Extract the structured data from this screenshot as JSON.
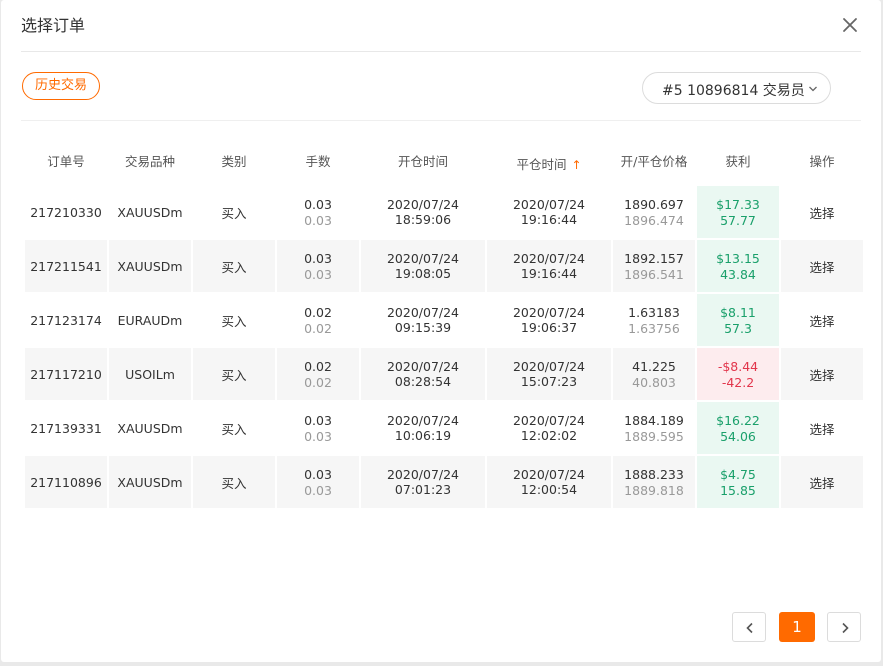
{
  "modal": {
    "title": "选择订单"
  },
  "filters": {
    "history_tag": "历史交易",
    "account_selected": "#5 10896814 交易员"
  },
  "table": {
    "headers": [
      "订单号",
      "交易品种",
      "类别",
      "手数",
      "开仓时间",
      "平仓时间",
      "开/平仓价格",
      "获利",
      "操作"
    ],
    "sort_indicator": "↑",
    "rows": [
      {
        "order": "217210330",
        "symbol": "XAUUSDm",
        "type": "买入",
        "lots": "0.03",
        "lots2": "0.03",
        "open_time": "2020/07/24 18:59:06",
        "close_time": "2020/07/24 19:16:44",
        "open_price": "1890.697",
        "close_price": "1896.474",
        "profit": "$17.33",
        "profit2": "57.77",
        "profit_sign": "pos",
        "action": "选择"
      },
      {
        "order": "217211541",
        "symbol": "XAUUSDm",
        "type": "买入",
        "lots": "0.03",
        "lots2": "0.03",
        "open_time": "2020/07/24 19:08:05",
        "close_time": "2020/07/24 19:16:44",
        "open_price": "1892.157",
        "close_price": "1896.541",
        "profit": "$13.15",
        "profit2": "43.84",
        "profit_sign": "pos",
        "action": "选择"
      },
      {
        "order": "217123174",
        "symbol": "EURAUDm",
        "type": "买入",
        "lots": "0.02",
        "lots2": "0.02",
        "open_time": "2020/07/24 09:15:39",
        "close_time": "2020/07/24 19:06:37",
        "open_price": "1.63183",
        "close_price": "1.63756",
        "profit": "$8.11",
        "profit2": "57.3",
        "profit_sign": "pos",
        "action": "选择"
      },
      {
        "order": "217117210",
        "symbol": "USOILm",
        "type": "买入",
        "lots": "0.02",
        "lots2": "0.02",
        "open_time": "2020/07/24 08:28:54",
        "close_time": "2020/07/24 15:07:23",
        "open_price": "41.225",
        "close_price": "40.803",
        "profit": "-$8.44",
        "profit2": "-42.2",
        "profit_sign": "neg",
        "action": "选择"
      },
      {
        "order": "217139331",
        "symbol": "XAUUSDm",
        "type": "买入",
        "lots": "0.03",
        "lots2": "0.03",
        "open_time": "2020/07/24 10:06:19",
        "close_time": "2020/07/24 12:02:02",
        "open_price": "1884.189",
        "close_price": "1889.595",
        "profit": "$16.22",
        "profit2": "54.06",
        "profit_sign": "pos",
        "action": "选择"
      },
      {
        "order": "217110896",
        "symbol": "XAUUSDm",
        "type": "买入",
        "lots": "0.03",
        "lots2": "0.03",
        "open_time": "2020/07/24 07:01:23",
        "close_time": "2020/07/24 12:00:54",
        "open_price": "1888.233",
        "close_price": "1889.818",
        "profit": "$4.75",
        "profit2": "15.85",
        "profit_sign": "pos",
        "action": "选择"
      }
    ]
  },
  "pagination": {
    "current": "1"
  },
  "colors": {
    "accent": "#ff6a00",
    "profit_positive": "#1aa06b",
    "profit_negative": "#e2364c"
  },
  "icons": {
    "close": "close-icon",
    "dropdown": "chevron-down-icon",
    "prev": "chevron-left-icon",
    "next": "chevron-right-icon"
  }
}
